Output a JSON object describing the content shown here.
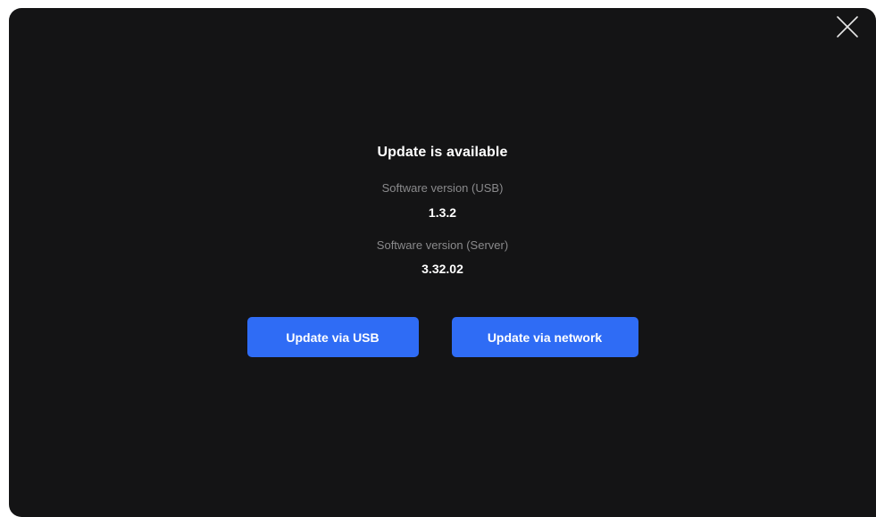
{
  "dialog": {
    "title": "Update is available",
    "close_icon": "close-icon",
    "usb_version": {
      "label": "Software version (USB)",
      "value": "1.3.2"
    },
    "server_version": {
      "label": "Software version (Server)",
      "value": "3.32.02"
    },
    "buttons": {
      "update_usb": "Update via USB",
      "update_network": "Update via network"
    }
  },
  "colors": {
    "background": "#141415",
    "accent": "#2f6cf5",
    "muted_text": "#8a8a8c",
    "text": "#ffffff"
  }
}
